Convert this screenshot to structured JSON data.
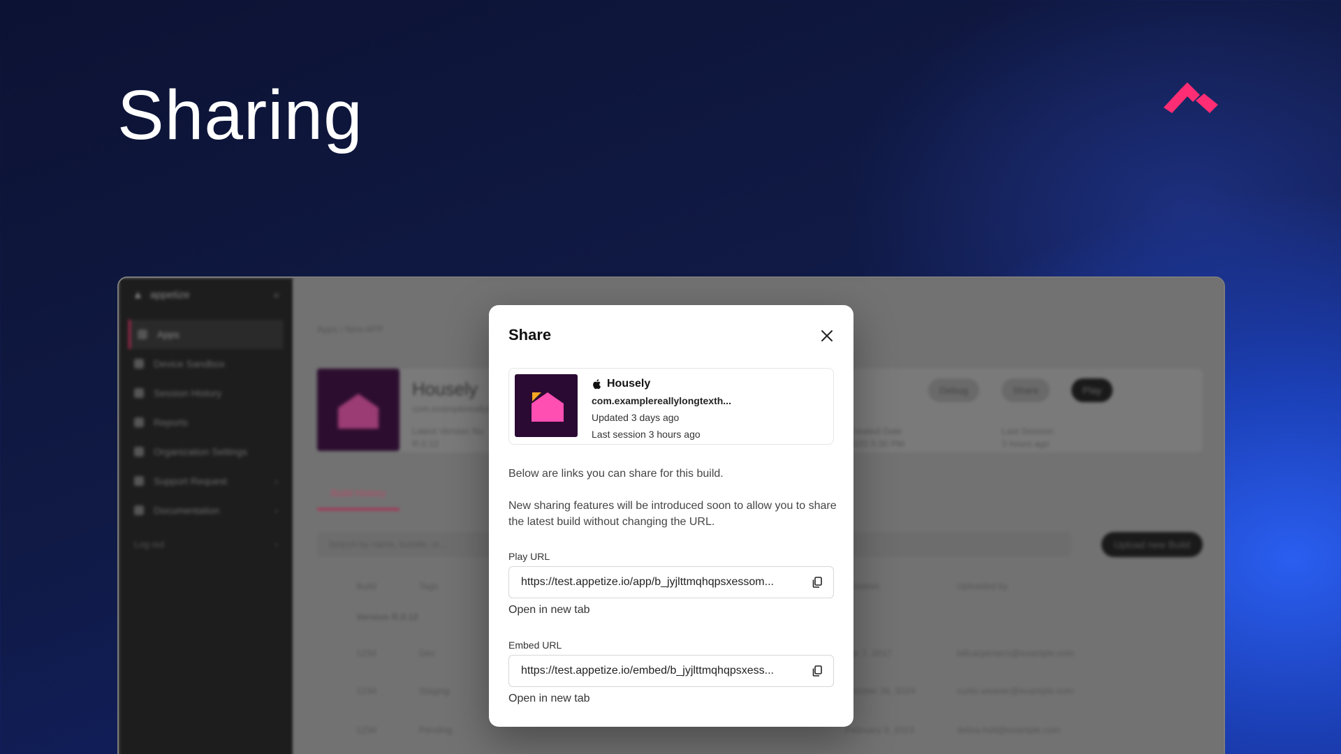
{
  "hero": {
    "title": "Sharing"
  },
  "colors": {
    "brand": "#ff2d73",
    "accent": "#b0284f"
  },
  "background_app": {
    "brand": "appetize",
    "sidebar": {
      "items": [
        {
          "label": "Apps",
          "icon": "apps-icon"
        },
        {
          "label": "Device Sandbox",
          "icon": "device-icon"
        },
        {
          "label": "Session History",
          "icon": "history-icon"
        },
        {
          "label": "Reports",
          "icon": "reports-icon"
        },
        {
          "label": "Organization Settings",
          "icon": "settings-icon"
        },
        {
          "label": "Support Request",
          "icon": "support-icon"
        },
        {
          "label": "Documentation",
          "icon": "docs-icon"
        }
      ],
      "footer": "Log out"
    },
    "breadcrumb": "Apps  /  New APP",
    "app_name": "Housely",
    "bundle": "com.examplereallylong",
    "meta": [
      "Latest Version Nu",
      "R.0.12",
      "Created Date",
      "2020 5:30 PM",
      "Last Session",
      "3 hours ago"
    ],
    "buttons": {
      "debug": "Debug",
      "share": "Share",
      "play": "Play"
    },
    "tab": "Build History",
    "search_placeholder": "Search by name, bundle, or...",
    "upload": "Upload new Build",
    "headers": [
      "Build",
      "Tags",
      "Creation",
      "Uploaded by"
    ],
    "version_row": "Version R.0.12",
    "rows": [
      {
        "build": "1234",
        "tag": "Dev",
        "date": "Apr 7, 2017",
        "by": "billcarpenters@example.com"
      },
      {
        "build": "1234",
        "tag": "Staging",
        "date": "October 26, 2024",
        "by": "curtis.weaver@example.com"
      },
      {
        "build": "1234",
        "tag": "Pending",
        "date": "February 9, 2023",
        "by": "debra.holt@example.com"
      }
    ]
  },
  "modal": {
    "title": "Share",
    "app": {
      "name": "Housely",
      "bundle": "com.examplereallylongtexth...",
      "updated": "Updated 3 days ago",
      "last_session": "Last session 3 hours ago"
    },
    "intro": "Below are links you can share for this build.",
    "notice": "New sharing features will be introduced soon to allow you to share the latest build without changing the URL.",
    "play_url": {
      "label": "Play URL",
      "value": "https://test.appetize.io/app/b_jyjlttmqhqpsxessom...",
      "open": "Open in new tab"
    },
    "embed_url": {
      "label": "Embed URL",
      "value": "https://test.appetize.io/embed/b_jyjlttmqhqpsxess...",
      "open": "Open in new tab"
    }
  }
}
